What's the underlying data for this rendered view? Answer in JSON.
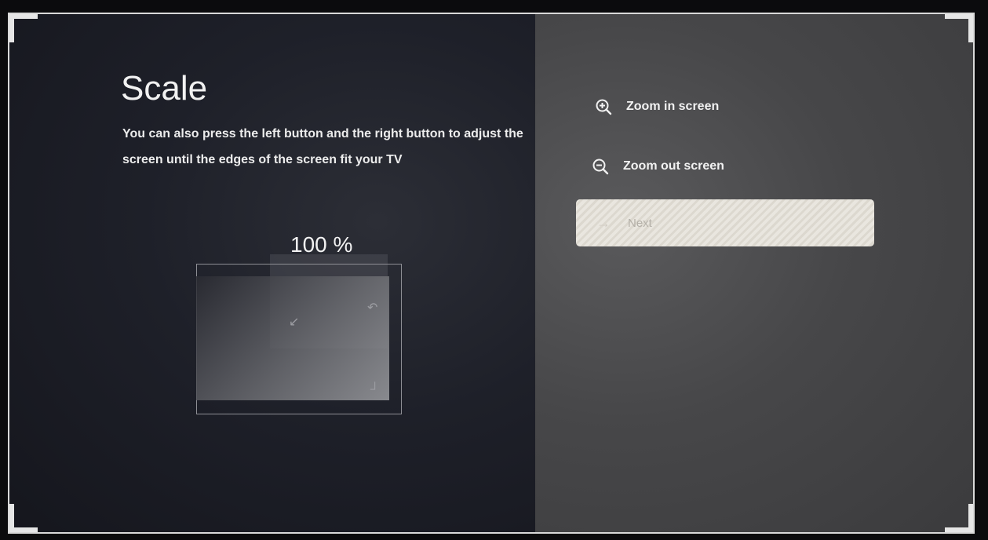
{
  "screen": {
    "title": "Scale",
    "description": "You can also press the left button and the right button to adjust the screen until the edges of the screen fit your TV",
    "scale_percent_label": "100 %",
    "scale_percent": 100
  },
  "menu": {
    "zoom_in_label": "Zoom in screen",
    "zoom_out_label": "Zoom out screen",
    "next_label": "Next"
  },
  "icons": {
    "zoom_in": "zoom-in-icon",
    "zoom_out": "zoom-out-icon",
    "next_arrow": "arrow-right-icon"
  },
  "colors": {
    "left_pane": "#1e2029",
    "right_pane": "#474749",
    "text": "#f2f2f2",
    "next_button_bg": "#e9e6df",
    "next_button_text": "#b4b0a8"
  }
}
